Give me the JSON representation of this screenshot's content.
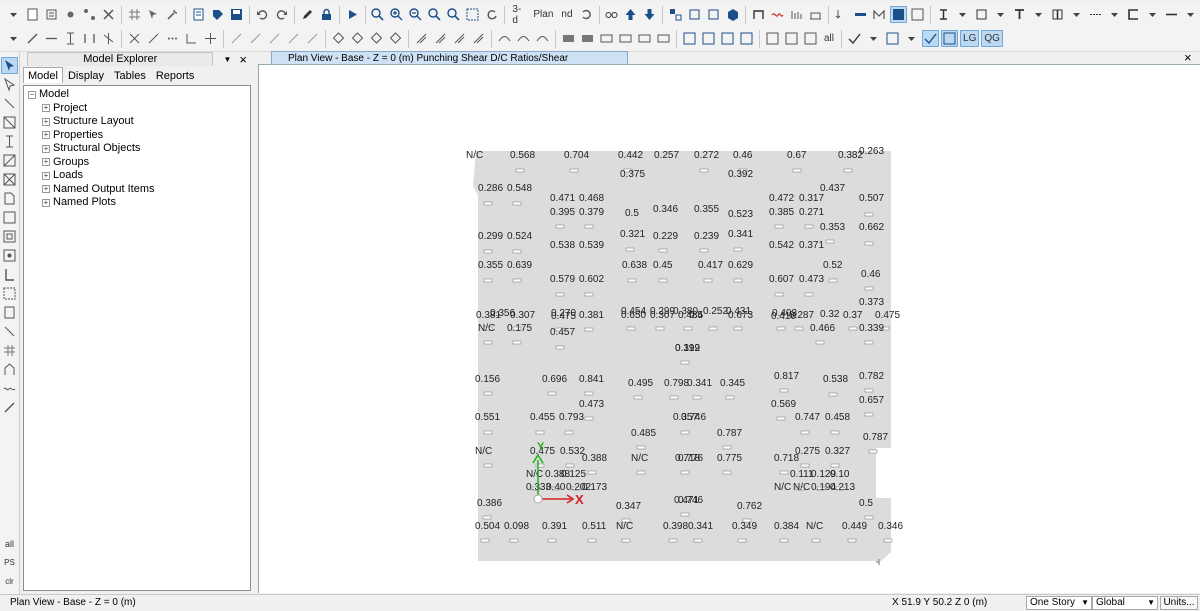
{
  "toolbar1": {
    "buttons": [
      "new-model",
      "open",
      "save",
      "undo",
      "redo",
      "draw",
      "lock",
      "run",
      "zoom-window",
      "zoom-in",
      "zoom-out",
      "zoom-extents",
      "zoom-previous",
      "pan",
      "3d-view",
      "plan-view",
      "elev-view",
      "rotate",
      "display-options",
      "move-up",
      "move-down",
      "set-elements",
      "set-building",
      "show-undeformed",
      "object-shrink",
      "show-deformed",
      "show-forces",
      "show-stresses",
      "assign",
      "frame",
      "floor",
      "wall",
      "link",
      "tendon",
      "slab",
      "column-section",
      "beam-section",
      "dimension",
      "units"
    ],
    "label_3d": "3-d",
    "label_plan": "Plan",
    "label_nd": "nd"
  },
  "toolbar2": {
    "label_all": "all",
    "label_lg": "LG",
    "label_qg": "QG"
  },
  "vtoolbar": {
    "label_all": "all",
    "label_ps": "PS",
    "label_clr": "clr"
  },
  "explorer": {
    "title": "Model Explorer",
    "close": "×",
    "tabs": [
      "Model",
      "Display",
      "Tables",
      "Reports"
    ],
    "active_tab": "Model",
    "tree": {
      "root": "Model",
      "children": [
        "Project",
        "Structure Layout",
        "Properties",
        "Structural Objects",
        "Groups",
        "Loads",
        "Named Output Items",
        "Named Plots"
      ]
    }
  },
  "view": {
    "title": "Plan View - Base - Z = 0 (m)  Punching Shear D/C Ratios/Shear Reinforcement",
    "close": "×",
    "axis_x": "X",
    "axis_y": "Y",
    "ratios": [
      {
        "t": "N/C"
      },
      {
        "t": "0.568"
      },
      {
        "t": "0.704"
      },
      {
        "t": "0.442"
      },
      {
        "t": "0.257"
      },
      {
        "t": "0.272"
      },
      {
        "t": "0.46"
      },
      {
        "t": "0.67"
      },
      {
        "t": "0.382"
      },
      {
        "t": "0.263"
      },
      {
        "t": "0.375"
      },
      {
        "t": "0.392"
      },
      {
        "t": "0.286"
      },
      {
        "t": "0.548"
      },
      {
        "t": "0.437"
      },
      {
        "t": "0.471"
      },
      {
        "t": "0.468"
      },
      {
        "t": "0.472"
      },
      {
        "t": "0.317"
      },
      {
        "t": "0.507"
      },
      {
        "t": "0.395"
      },
      {
        "t": "0.379"
      },
      {
        "t": "0.5"
      },
      {
        "t": "0.346"
      },
      {
        "t": "0.355"
      },
      {
        "t": "0.523"
      },
      {
        "t": "0.385"
      },
      {
        "t": "0.271"
      },
      {
        "t": "0.353"
      },
      {
        "t": "0.662"
      },
      {
        "t": "0.299"
      },
      {
        "t": "0.524"
      },
      {
        "t": "0.321"
      },
      {
        "t": "0.229"
      },
      {
        "t": "0.239"
      },
      {
        "t": "0.341"
      },
      {
        "t": "0.538"
      },
      {
        "t": "0.539"
      },
      {
        "t": "0.542"
      },
      {
        "t": "0.371"
      },
      {
        "t": "0.355"
      },
      {
        "t": "0.639"
      },
      {
        "t": "0.638"
      },
      {
        "t": "0.45"
      },
      {
        "t": "0.417"
      },
      {
        "t": "0.629"
      },
      {
        "t": "0.52"
      },
      {
        "t": "0.46"
      },
      {
        "t": "0.579"
      },
      {
        "t": "0.602"
      },
      {
        "t": "0.607"
      },
      {
        "t": "0.473"
      },
      {
        "t": "0.373"
      },
      {
        "t": "0.381"
      },
      {
        "t": "0.356"
      },
      {
        "t": "0.307"
      },
      {
        "t": "0.270"
      },
      {
        "t": "0.475"
      },
      {
        "t": "0.381"
      },
      {
        "t": "0.454"
      },
      {
        "t": "0.650"
      },
      {
        "t": "0.299"
      },
      {
        "t": "0.307"
      },
      {
        "t": "0.380"
      },
      {
        "t": "0.485"
      },
      {
        "t": "0.252"
      },
      {
        "t": "0.4"
      },
      {
        "t": "0.431"
      },
      {
        "t": "0.673"
      },
      {
        "t": "0.403"
      },
      {
        "t": "0.410"
      },
      {
        "t": "0.287"
      },
      {
        "t": "0.32"
      },
      {
        "t": "0.37"
      },
      {
        "t": "0.475"
      },
      {
        "t": "N/C"
      },
      {
        "t": "0.175"
      },
      {
        "t": "0.466"
      },
      {
        "t": "0.339"
      },
      {
        "t": "0.457"
      },
      {
        "t": "0.319"
      },
      {
        "t": "0.192"
      },
      {
        "t": "0.156"
      },
      {
        "t": "0.696"
      },
      {
        "t": "0.841"
      },
      {
        "t": "0.495"
      },
      {
        "t": "0.798"
      },
      {
        "t": "0.341"
      },
      {
        "t": "0.345"
      },
      {
        "t": "0.817"
      },
      {
        "t": "0.538"
      },
      {
        "t": "0.782"
      },
      {
        "t": "0.473"
      },
      {
        "t": "0.569"
      },
      {
        "t": "0.657"
      },
      {
        "t": "0.551"
      },
      {
        "t": "0.455"
      },
      {
        "t": "0.793"
      },
      {
        "t": "0.357"
      },
      {
        "t": "0.746"
      },
      {
        "t": "0.747"
      },
      {
        "t": "0.458"
      },
      {
        "t": "0.485"
      },
      {
        "t": "0.787"
      },
      {
        "t": "0.787"
      },
      {
        "t": "N/C"
      },
      {
        "t": "0.475"
      },
      {
        "t": "0.532"
      },
      {
        "t": "0.275"
      },
      {
        "t": "0.327"
      },
      {
        "t": "0.388"
      },
      {
        "t": "N/C"
      },
      {
        "t": "0.718"
      },
      {
        "t": "0.776"
      },
      {
        "t": "0.775"
      },
      {
        "t": "0.718"
      },
      {
        "t": "N/C"
      },
      {
        "t": "0.388"
      },
      {
        "t": "0.125"
      },
      {
        "t": "0.111"
      },
      {
        "t": "0.129"
      },
      {
        "t": "0.10"
      },
      {
        "t": "0.333"
      },
      {
        "t": "0.40"
      },
      {
        "t": "0.202"
      },
      {
        "t": "0.173"
      },
      {
        "t": "N/C"
      },
      {
        "t": "N/C"
      },
      {
        "t": "0.194"
      },
      {
        "t": "0.213"
      },
      {
        "t": "0.386"
      },
      {
        "t": "0.347"
      },
      {
        "t": "0.471"
      },
      {
        "t": "0.746"
      },
      {
        "t": "0.762"
      },
      {
        "t": "0.5"
      },
      {
        "t": "0.504"
      },
      {
        "t": "0.098"
      },
      {
        "t": "0.391"
      },
      {
        "t": "0.511"
      },
      {
        "t": "N/C"
      },
      {
        "t": "0.398"
      },
      {
        "t": "0.341"
      },
      {
        "t": "0.349"
      },
      {
        "t": "0.384"
      },
      {
        "t": "N/C"
      },
      {
        "t": "0.449"
      },
      {
        "t": "0.346"
      },
      {
        "t": "N/C"
      }
    ]
  },
  "status": {
    "view_label": "Plan View - Base - Z = 0 (m)",
    "coords": "X 51.9  Y 50.2  Z 0 (m)",
    "story": "One Story",
    "coord_sys": "Global",
    "units": "Units..."
  }
}
